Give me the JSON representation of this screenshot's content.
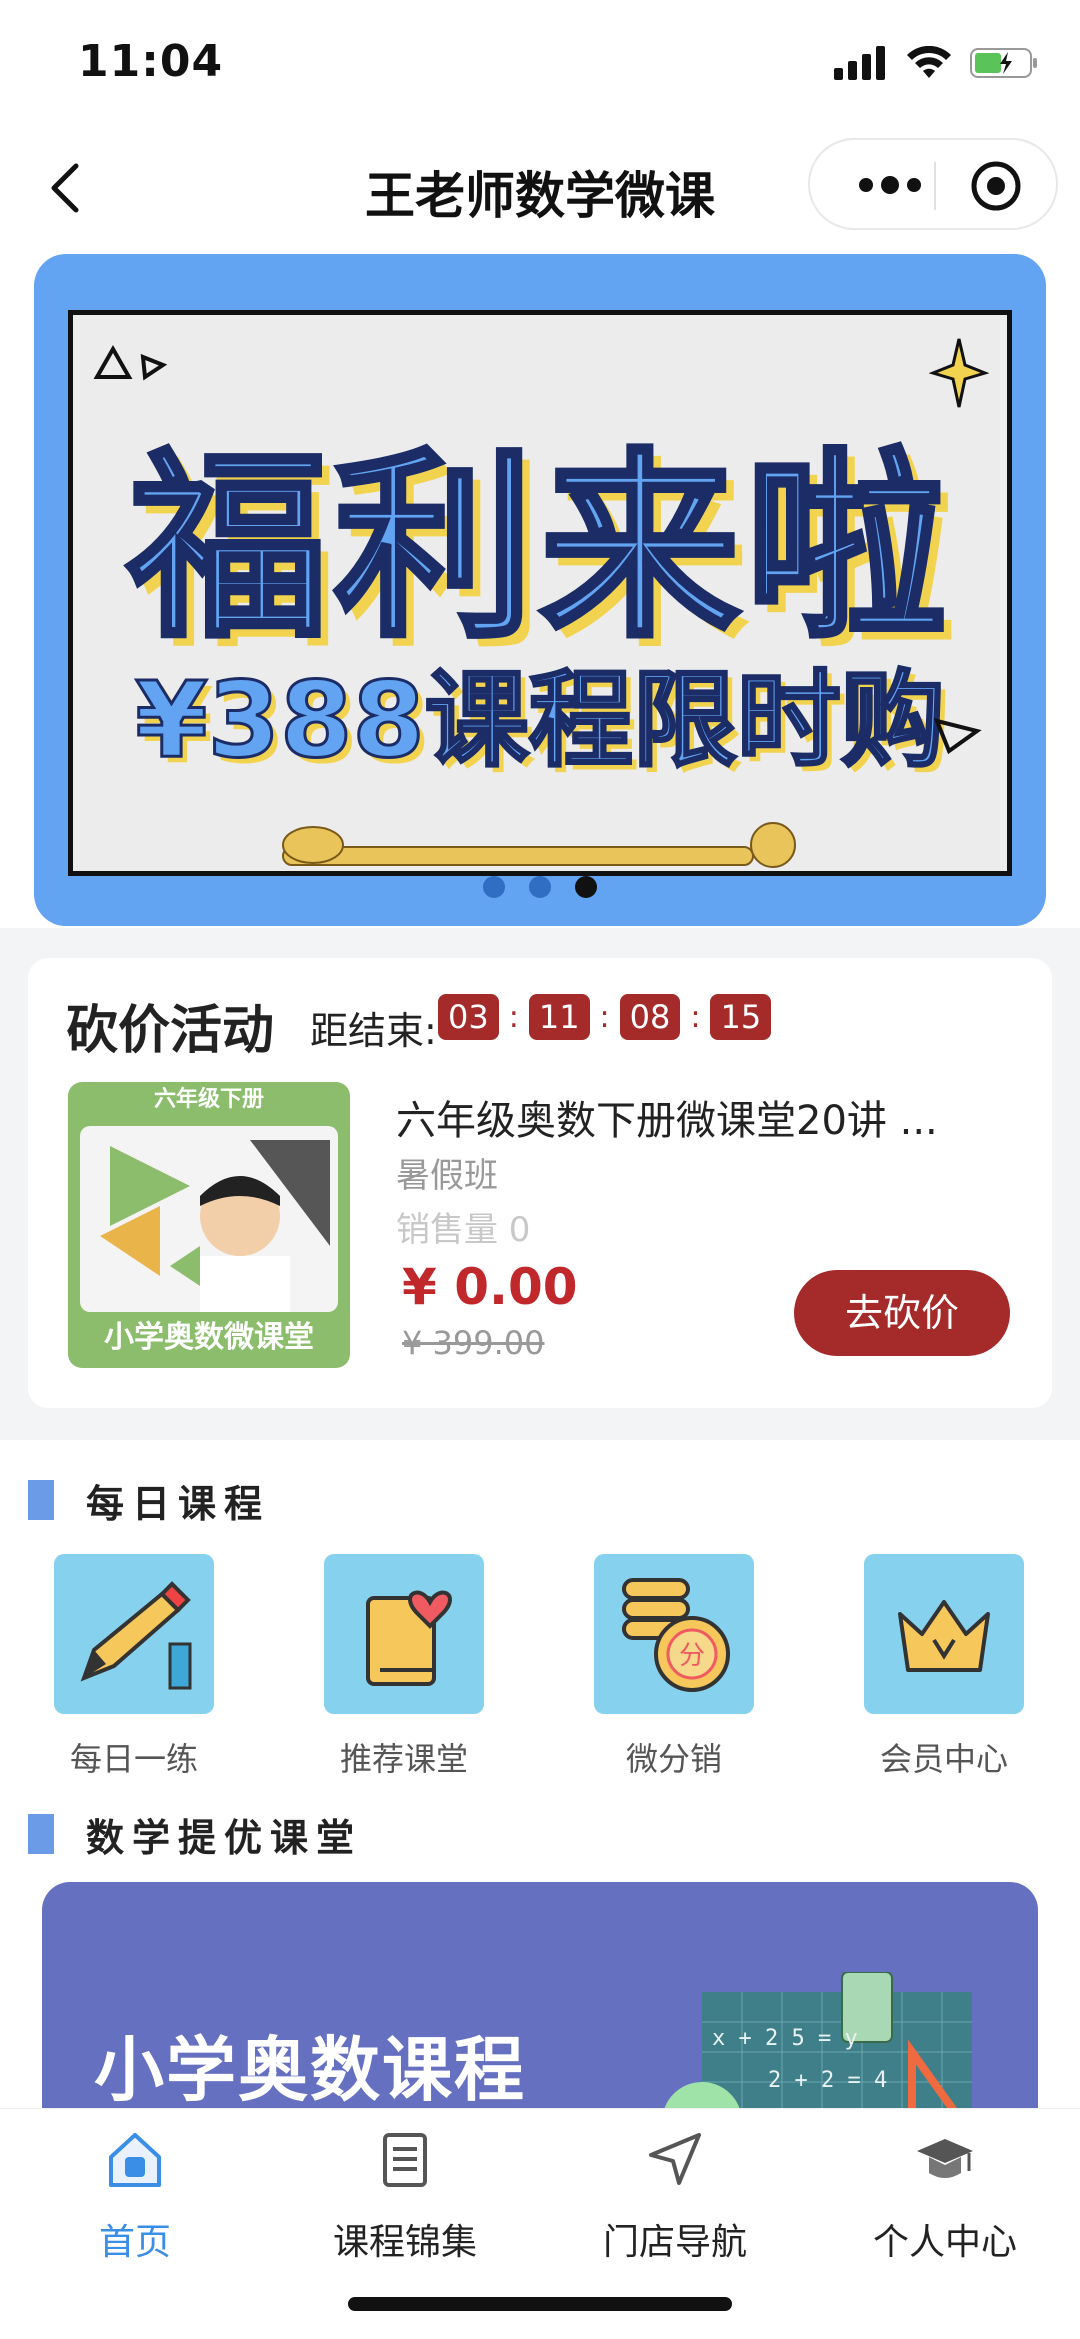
{
  "status_bar": {
    "time": "11:04"
  },
  "nav": {
    "title": "王老师数学微课"
  },
  "banner": {
    "title": "福利来啦",
    "subtitle": "¥388课程限时购",
    "dots": 3,
    "active_dot": 3
  },
  "bargain": {
    "title": "砍价活动",
    "countdown_label": "距结束:",
    "countdown": [
      "03",
      "11",
      "08",
      "15"
    ],
    "thumb_top": "六年级下册",
    "thumb_bottom": "小学奥数微课堂",
    "course_name": "六年级奥数下册微课堂20讲 ...",
    "tag": "暑假班",
    "sales": "销售量 0",
    "price": "¥ 0.00",
    "original_price": "¥ 399.00",
    "button": "去砍价"
  },
  "daily_courses": {
    "heading": "每日课程",
    "items": [
      {
        "label": "每日一练",
        "icon": "pen-icon"
      },
      {
        "label": "推荐课堂",
        "icon": "book-heart-icon"
      },
      {
        "label": "微分销",
        "icon": "coins-icon"
      },
      {
        "label": "会员中心",
        "icon": "crown-icon"
      }
    ]
  },
  "math_section": {
    "heading": "数学提优课堂",
    "promo_title": "小学奥数课程",
    "promo_formula_1": "x + 2 5 = y",
    "promo_formula_2": "2 + 2 = 4"
  },
  "tab_bar": {
    "items": [
      {
        "label": "首页",
        "icon": "home-icon",
        "active": true
      },
      {
        "label": "课程锦集",
        "icon": "collection-icon",
        "active": false
      },
      {
        "label": "门店导航",
        "icon": "navigation-icon",
        "active": false
      },
      {
        "label": "个人中心",
        "icon": "graduation-cap-icon",
        "active": false
      }
    ]
  },
  "colors": {
    "primary_blue": "#62a3f2",
    "accent_red": "#a52a2a",
    "price_red": "#c0282b",
    "tab_active": "#3a8ee6",
    "icon_tile": "#86d2ee",
    "promo_bg": "#6570c1"
  }
}
